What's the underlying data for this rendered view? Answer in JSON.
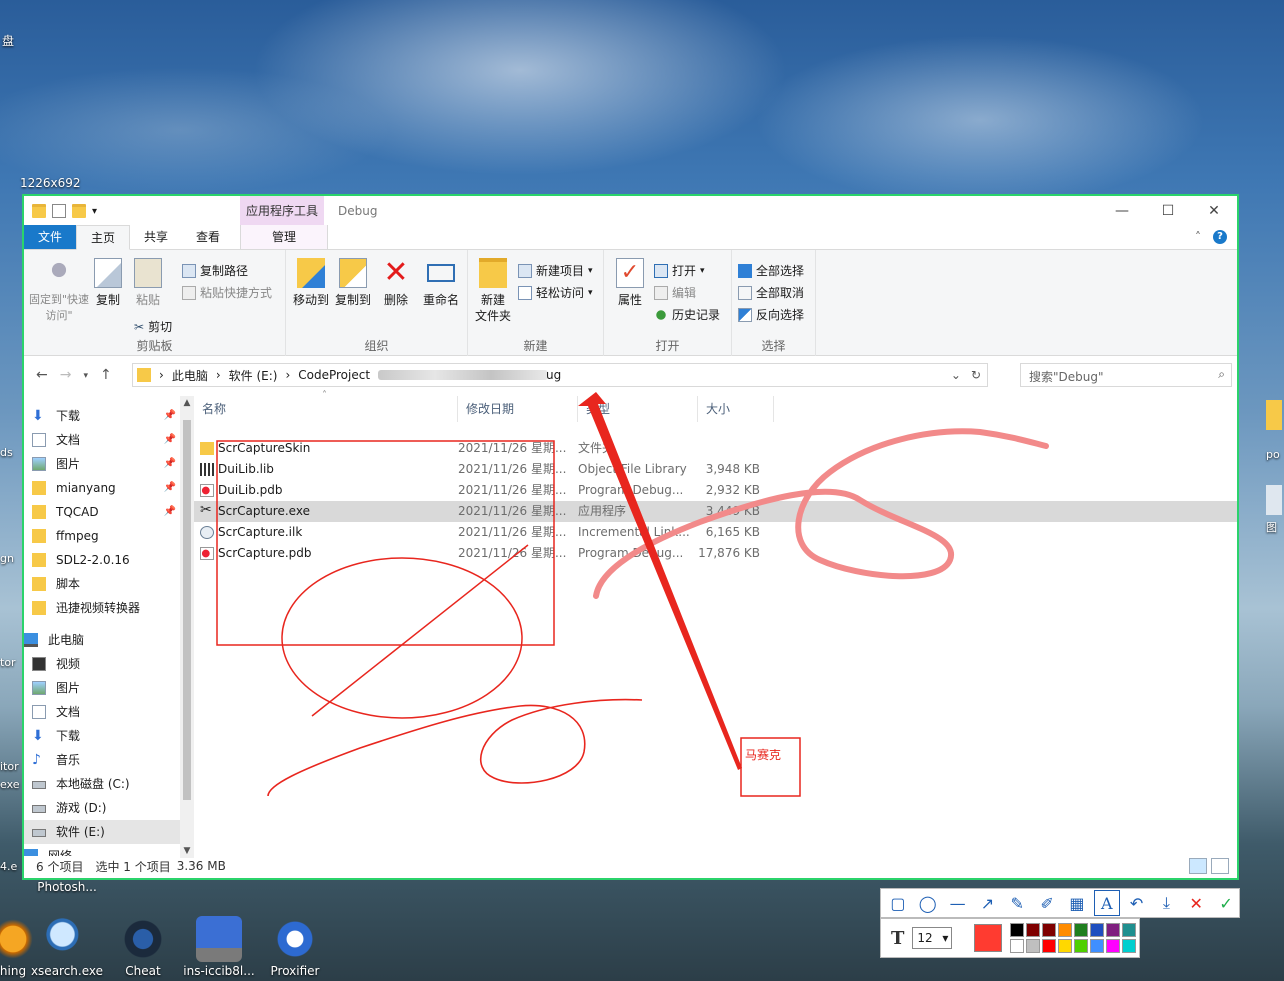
{
  "overlay": {
    "size_label": "1226x692",
    "mosaic_text": "马赛克"
  },
  "desktop": {
    "top_left_label": "盘",
    "side_left": [
      "ds",
      "gn",
      "tor",
      "itor",
      "exe",
      "4.e"
    ],
    "side_right": [
      "po",
      "图"
    ],
    "icons": [
      {
        "label": "Photosh...",
        "name": "photoshop-desktop-icon"
      },
      {
        "label": "hing",
        "name": "partial-desktop-icon"
      },
      {
        "label": "xsearch.exe",
        "name": "xsearch-desktop-icon"
      },
      {
        "label": "Cheat",
        "name": "cheat-engine-desktop-icon"
      },
      {
        "label": "ins-iccib8l...",
        "name": "network-desktop-icon"
      },
      {
        "label": "Proxifier",
        "name": "proxifier-desktop-icon"
      }
    ]
  },
  "window": {
    "tool_tab": "应用程序工具",
    "title": "Debug",
    "tabs": [
      "文件",
      "主页",
      "共享",
      "查看",
      "管理"
    ],
    "ribbon": {
      "clipboard": {
        "label": "剪贴板",
        "pin": "固定到\"快速访问\"",
        "copy": "复制",
        "paste": "粘贴",
        "copy_path": "复制路径",
        "paste_shortcut": "粘贴快捷方式",
        "cut": "剪切"
      },
      "organize": {
        "label": "组织",
        "move_to": "移动到",
        "copy_to": "复制到",
        "delete": "删除",
        "rename": "重命名"
      },
      "new": {
        "label": "新建",
        "new_folder": "新建\n文件夹",
        "new_item": "新建项目",
        "easy_access": "轻松访问"
      },
      "open": {
        "label": "打开",
        "properties": "属性",
        "open": "打开",
        "edit": "编辑",
        "history": "历史记录"
      },
      "select": {
        "label": "选择",
        "select_all": "全部选择",
        "select_none": "全部取消",
        "invert": "反向选择"
      }
    },
    "address": {
      "parts": [
        "此电脑",
        "软件 (E:)",
        "CodeProject"
      ],
      "tail": "ug"
    },
    "search_placeholder": "搜索\"Debug\"",
    "nav": {
      "quick": [
        {
          "label": "下载",
          "icon": "download-icon",
          "pinned": true
        },
        {
          "label": "文档",
          "icon": "document-icon",
          "pinned": true
        },
        {
          "label": "图片",
          "icon": "picture-icon",
          "pinned": true
        },
        {
          "label": "mianyang",
          "icon": "folder-icon",
          "pinned": true
        },
        {
          "label": "TQCAD",
          "icon": "folder-icon",
          "pinned": true
        },
        {
          "label": "ffmpeg",
          "icon": "folder-icon",
          "pinned": false
        },
        {
          "label": "SDL2-2.0.16",
          "icon": "folder-icon",
          "pinned": false
        },
        {
          "label": "脚本",
          "icon": "folder-icon",
          "pinned": false
        },
        {
          "label": "迅捷视频转换器",
          "icon": "folder-icon",
          "pinned": false
        }
      ],
      "this_pc": "此电脑",
      "pc_items": [
        {
          "label": "视频",
          "icon": "video-icon"
        },
        {
          "label": "图片",
          "icon": "picture-icon"
        },
        {
          "label": "文档",
          "icon": "document-icon"
        },
        {
          "label": "下载",
          "icon": "download-icon"
        },
        {
          "label": "音乐",
          "icon": "music-icon"
        },
        {
          "label": "本地磁盘 (C:)",
          "icon": "drive-icon"
        },
        {
          "label": "游戏 (D:)",
          "icon": "drive-icon"
        },
        {
          "label": "软件 (E:)",
          "icon": "drive-icon"
        }
      ],
      "network": "网络"
    },
    "columns": [
      "名称",
      "修改日期",
      "类型",
      "大小"
    ],
    "files": [
      {
        "name": "ScrCaptureSkin",
        "date": "2021/11/26 星期...",
        "type": "文件夹",
        "size": "",
        "icon": "folder-icon"
      },
      {
        "name": "DuiLib.lib",
        "date": "2021/11/26 星期...",
        "type": "Object File Library",
        "size": "3,948 KB",
        "icon": "library-file-icon"
      },
      {
        "name": "DuiLib.pdb",
        "date": "2021/11/26 星期...",
        "type": "Program Debug...",
        "size": "2,932 KB",
        "icon": "pdb-file-icon"
      },
      {
        "name": "ScrCapture.exe",
        "date": "2021/11/26 星期...",
        "type": "应用程序",
        "size": "3,449 KB",
        "icon": "scissors-icon"
      },
      {
        "name": "ScrCapture.ilk",
        "date": "2021/11/26 星期...",
        "type": "Incremental Link...",
        "size": "6,165 KB",
        "icon": "ilk-file-icon"
      },
      {
        "name": "ScrCapture.pdb",
        "date": "2021/11/26 星期...",
        "type": "Program Debug...",
        "size": "17,876 KB",
        "icon": "pdb-file-icon"
      }
    ],
    "status": {
      "count": "6 个项目",
      "selected": "选中 1 个项目",
      "size": "3.36 MB"
    }
  },
  "capture_toolbar": {
    "tools": [
      {
        "name": "rectangle-tool-icon",
        "glyph": "▢"
      },
      {
        "name": "ellipse-tool-icon",
        "glyph": "◯"
      },
      {
        "name": "line-tool-icon",
        "glyph": "—"
      },
      {
        "name": "arrow-tool-icon",
        "glyph": "↗"
      },
      {
        "name": "pen-tool-icon",
        "glyph": "✎"
      },
      {
        "name": "marker-tool-icon",
        "glyph": "✐"
      },
      {
        "name": "mosaic-tool-icon",
        "glyph": "▦"
      },
      {
        "name": "text-tool-icon",
        "glyph": "A"
      },
      {
        "name": "undo-icon",
        "glyph": "↶"
      },
      {
        "name": "save-icon",
        "glyph": "⤓"
      },
      {
        "name": "cancel-icon",
        "glyph": "✕"
      },
      {
        "name": "confirm-icon",
        "glyph": "✓"
      }
    ],
    "text_glyph": "T",
    "font_size": "12",
    "current_color": "#ff3b30",
    "palette": [
      "#000000",
      "#7f0000",
      "#7f0000",
      "#ff8c00",
      "#1f7f1f",
      "#1f4fbf",
      "#7f1f7f",
      "#1f8f8f",
      "#ffffff",
      "#bfbfbf",
      "#ff0000",
      "#ffd800",
      "#4fcf00",
      "#3f8fff",
      "#ff00ff",
      "#00cfcf"
    ]
  },
  "colors": {
    "accent": "#1979ca",
    "capture_border": "#2bd36b",
    "annotation": "#e8261e"
  }
}
